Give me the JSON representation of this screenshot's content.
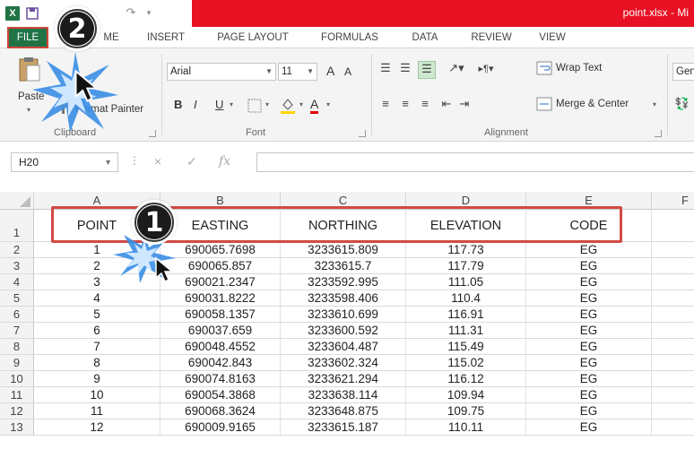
{
  "titlebar": {
    "logo": "X→",
    "doc_title": "point.xlsx - Mi"
  },
  "tabs": [
    {
      "label": "FILE",
      "x": 0
    },
    {
      "label": "ME"
    },
    {
      "label": "INSERT"
    },
    {
      "label": "PAGE LAYOUT"
    },
    {
      "label": "FORMULAS"
    },
    {
      "label": "DATA"
    },
    {
      "label": "REVIEW"
    },
    {
      "label": "VIEW"
    }
  ],
  "ribbon": {
    "clipboard": {
      "paste": "Paste",
      "format_painter": "Format Painter",
      "label": "Clipboard"
    },
    "font": {
      "font_name": "Arial",
      "font_size": "11",
      "bold": "B",
      "italic": "I",
      "underline": "U",
      "grow": "A",
      "shrink": "A",
      "font_color": "A",
      "label": "Font"
    },
    "alignment": {
      "wrap_text": "Wrap Text",
      "merge_center": "Merge & Center",
      "label": "Alignment"
    },
    "number": {
      "format": "Gen"
    }
  },
  "formula_bar": {
    "name_box": "H20",
    "cancel": "×",
    "enter": "✓",
    "fx": "fx",
    "value": ""
  },
  "columns": [
    "A",
    "B",
    "C",
    "D",
    "E",
    "F"
  ],
  "header_row": {
    "row_num": "1",
    "cells": [
      "POINT",
      "EASTING",
      "NORTHING",
      "ELEVATION",
      "CODE"
    ]
  },
  "rows": [
    {
      "n": "2",
      "cells": [
        "1",
        "690065.7698",
        "3233615.809",
        "117.73",
        "EG"
      ]
    },
    {
      "n": "3",
      "cells": [
        "2",
        "690065.857",
        "3233615.7",
        "117.79",
        "EG"
      ]
    },
    {
      "n": "4",
      "cells": [
        "3",
        "690021.2347",
        "3233592.995",
        "111.05",
        "EG"
      ]
    },
    {
      "n": "5",
      "cells": [
        "4",
        "690031.8222",
        "3233598.406",
        "110.4",
        "EG"
      ]
    },
    {
      "n": "6",
      "cells": [
        "5",
        "690058.1357",
        "3233610.699",
        "116.91",
        "EG"
      ]
    },
    {
      "n": "7",
      "cells": [
        "6",
        "690037.659",
        "3233600.592",
        "111.31",
        "EG"
      ]
    },
    {
      "n": "8",
      "cells": [
        "7",
        "690048.4552",
        "3233604.487",
        "115.49",
        "EG"
      ]
    },
    {
      "n": "9",
      "cells": [
        "8",
        "690042.843",
        "3233602.324",
        "115.02",
        "EG"
      ]
    },
    {
      "n": "10",
      "cells": [
        "9",
        "690074.8163",
        "3233621.294",
        "116.12",
        "EG"
      ]
    },
    {
      "n": "11",
      "cells": [
        "10",
        "690054.3868",
        "3233638.114",
        "109.94",
        "EG"
      ]
    },
    {
      "n": "12",
      "cells": [
        "11",
        "690068.3624",
        "3233648.875",
        "109.75",
        "EG"
      ]
    },
    {
      "n": "13",
      "cells": [
        "12",
        "690009.9165",
        "3233615.187",
        "110.11",
        "EG"
      ]
    }
  ],
  "callouts": {
    "step1": "1",
    "step2": "2"
  },
  "colors": {
    "excel_green": "#217346",
    "title_red": "#e81123",
    "highlight_red": "#d14a44"
  }
}
